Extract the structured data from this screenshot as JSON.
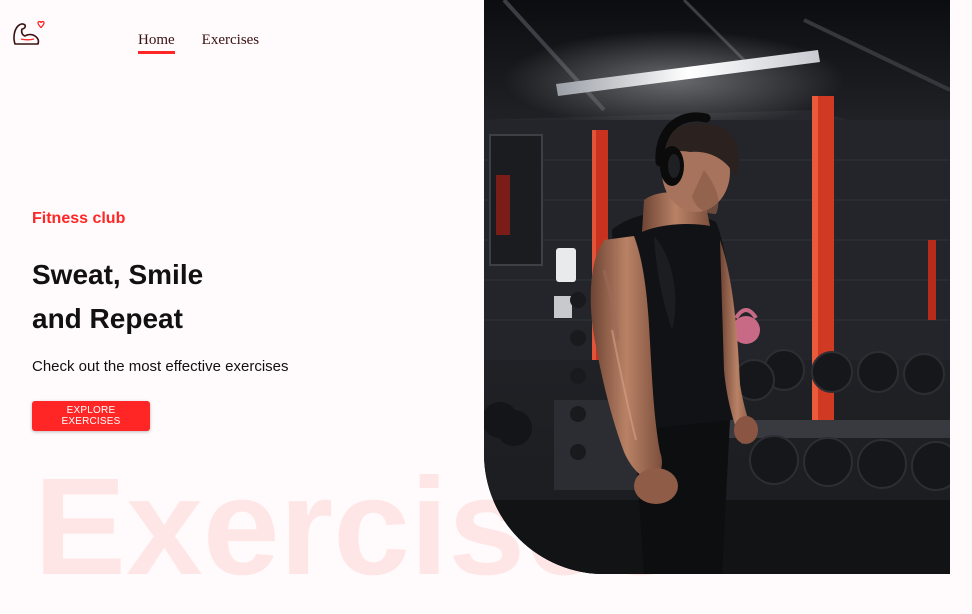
{
  "brand": {
    "logo_icon": "flexed-arm-heart-icon",
    "accent_color": "#ff2625"
  },
  "nav": {
    "items": [
      {
        "label": "Home",
        "active": true
      },
      {
        "label": "Exercises",
        "active": false
      }
    ]
  },
  "hero": {
    "eyebrow": "Fitness club",
    "title_line1": "Sweat, Smile",
    "title_line2": "and Repeat",
    "subtitle": "Check out the most effective exercises",
    "cta_label": "EXPLORE EXERCISES",
    "watermark": "Exercises",
    "image_subject": "man-in-gym-with-headphones-and-dumbbells"
  }
}
